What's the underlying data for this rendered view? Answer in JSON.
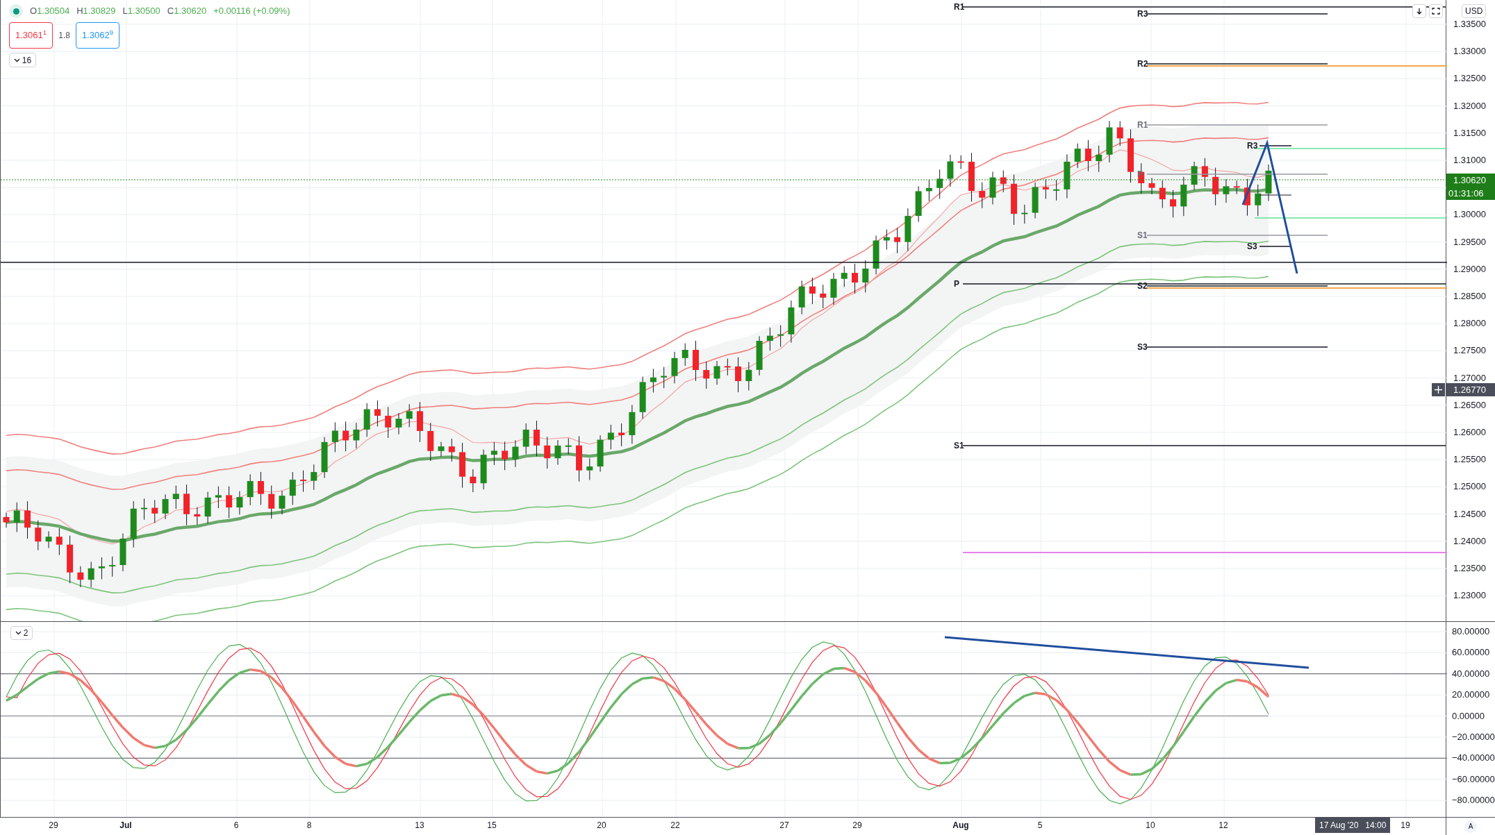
{
  "legend": {
    "ohlc": [
      {
        "key": "O",
        "value": "1.30504"
      },
      {
        "key": "H",
        "value": "1.30829"
      },
      {
        "key": "L",
        "value": "1.30500"
      },
      {
        "key": "C",
        "value": "1.30620"
      }
    ],
    "change": "+0.00116 (+0.09%)",
    "indicator_toggle": "16"
  },
  "quote": {
    "bid": "1.3061$^{1}$",
    "spread": "1.8",
    "ask": "1.3062$^{9}$"
  },
  "main_chart": {
    "currency": "USD",
    "price_scale": [
      "1.33500",
      "1.33000",
      "1.32500",
      "1.32000",
      "1.31500",
      "1.31000",
      "1.30000",
      "1.29500",
      "1.29000",
      "1.28500",
      "1.28000",
      "1.27500",
      "1.27000",
      "1.26500",
      "1.26000",
      "1.25500",
      "1.25000",
      "1.24500",
      "1.24000",
      "1.23500",
      "1.23000"
    ],
    "last_price": "1.30620",
    "countdown": "01:31:06",
    "crosshair_price": "1.26770",
    "pivot_labels": [
      {
        "label": "R1",
        "kind": "dark"
      },
      {
        "label": "R3",
        "kind": "dark"
      },
      {
        "label": "R2",
        "kind": "dark"
      },
      {
        "label": "R1",
        "kind": "muted"
      },
      {
        "label": "R3",
        "kind": "dark"
      },
      {
        "label": "P",
        "kind": "muted"
      },
      {
        "label": "S1",
        "kind": "muted"
      },
      {
        "label": "S3",
        "kind": "dark"
      },
      {
        "label": "P",
        "kind": "dark"
      },
      {
        "label": "S2",
        "kind": "dark"
      },
      {
        "label": "S3",
        "kind": "dark"
      },
      {
        "label": "S1",
        "kind": "dark"
      }
    ]
  },
  "oscillator": {
    "toggle": "2",
    "scale": [
      "80.00000",
      "60.00000",
      "40.00000",
      "20.00000",
      "0.00000",
      "−20.00000",
      "−40.00000",
      "−60.00000",
      "−80.00000"
    ]
  },
  "time_axis": {
    "labels": [
      {
        "text": "29",
        "bold": false
      },
      {
        "text": "Jul",
        "bold": true
      },
      {
        "text": "6",
        "bold": false
      },
      {
        "text": "8",
        "bold": false
      },
      {
        "text": "13",
        "bold": false
      },
      {
        "text": "15",
        "bold": false
      },
      {
        "text": "20",
        "bold": false
      },
      {
        "text": "22",
        "bold": false
      },
      {
        "text": "27",
        "bold": false
      },
      {
        "text": "29",
        "bold": false
      },
      {
        "text": "Aug",
        "bold": true
      },
      {
        "text": "5",
        "bold": false
      },
      {
        "text": "10",
        "bold": false
      },
      {
        "text": "12",
        "bold": false
      },
      {
        "text": "19",
        "bold": false
      }
    ],
    "crosshair_time": "17 Aug '20   14:00",
    "auto_button": "A"
  }
}
